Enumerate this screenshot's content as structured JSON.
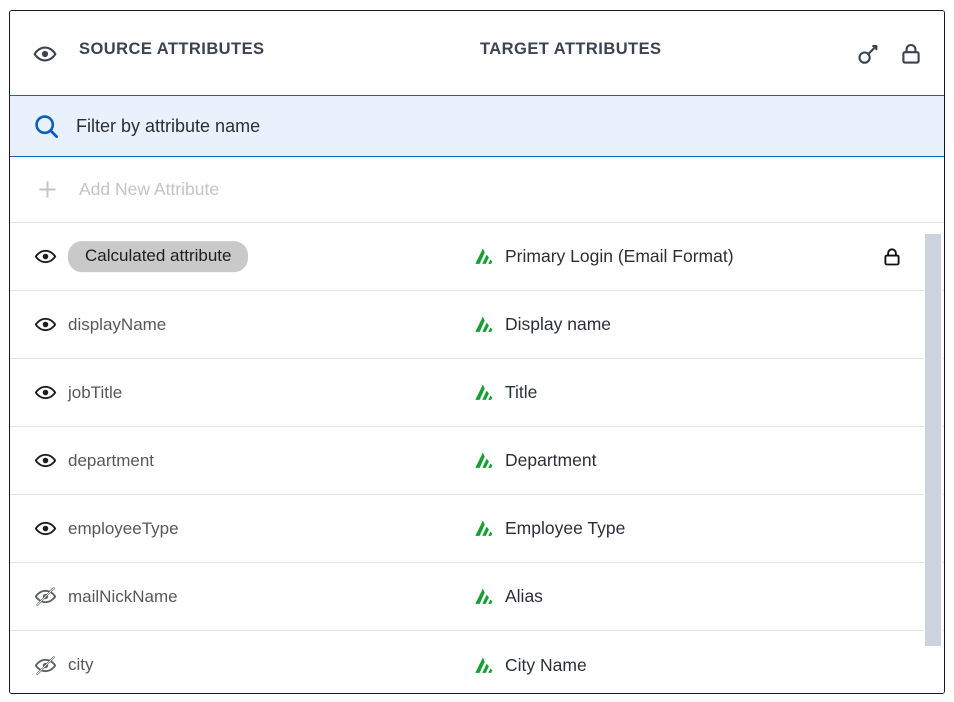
{
  "header": {
    "eye_icon": "eye-icon",
    "source_label": "SOURCE ATTRIBUTES",
    "target_label": "TARGET ATTRIBUTES",
    "key_icon": "key-icon",
    "lock_icon": "lock-icon"
  },
  "filter": {
    "icon": "search-icon",
    "placeholder": "Filter by attribute name",
    "value": ""
  },
  "add_new": {
    "icon": "plus-icon",
    "label": "Add New Attribute"
  },
  "colors": {
    "accent_blue": "#1464c0",
    "filter_bg": "#e9f1fc",
    "target_icon_green": "#18a034",
    "chip_bg": "#c9c9c9",
    "border_dark": "#15181d",
    "divider": "#e3e4e6",
    "scrollbar_thumb": "#ccd3de",
    "muted_text": "#c2c4c8"
  },
  "rows": [
    {
      "visibility": "visible",
      "visibility_icon": "eye-icon",
      "source": "Calculated attribute",
      "is_chip": true,
      "target_icon": "attribute-mapping-icon",
      "target": "Primary Login (Email Format)",
      "locked": true,
      "lock_icon": "lock-icon"
    },
    {
      "visibility": "visible",
      "visibility_icon": "eye-icon",
      "source": "displayName",
      "is_chip": false,
      "target_icon": "attribute-mapping-icon",
      "target": "Display name",
      "locked": false
    },
    {
      "visibility": "visible",
      "visibility_icon": "eye-icon",
      "source": "jobTitle",
      "is_chip": false,
      "target_icon": "attribute-mapping-icon",
      "target": "Title",
      "locked": false
    },
    {
      "visibility": "visible",
      "visibility_icon": "eye-icon",
      "source": "department",
      "is_chip": false,
      "target_icon": "attribute-mapping-icon",
      "target": "Department",
      "locked": false
    },
    {
      "visibility": "visible",
      "visibility_icon": "eye-icon",
      "source": "employeeType",
      "is_chip": false,
      "target_icon": "attribute-mapping-icon",
      "target": "Employee Type",
      "locked": false
    },
    {
      "visibility": "hidden",
      "visibility_icon": "eye-off-icon",
      "source": "mailNickName",
      "is_chip": false,
      "target_icon": "attribute-mapping-icon",
      "target": "Alias",
      "locked": false
    },
    {
      "visibility": "hidden",
      "visibility_icon": "eye-off-icon",
      "source": "city",
      "is_chip": false,
      "target_icon": "attribute-mapping-icon",
      "target": "City Name",
      "locked": false
    }
  ],
  "scrollbar": {
    "name": "vertical-scrollbar",
    "thumb_position_pct": 0
  }
}
